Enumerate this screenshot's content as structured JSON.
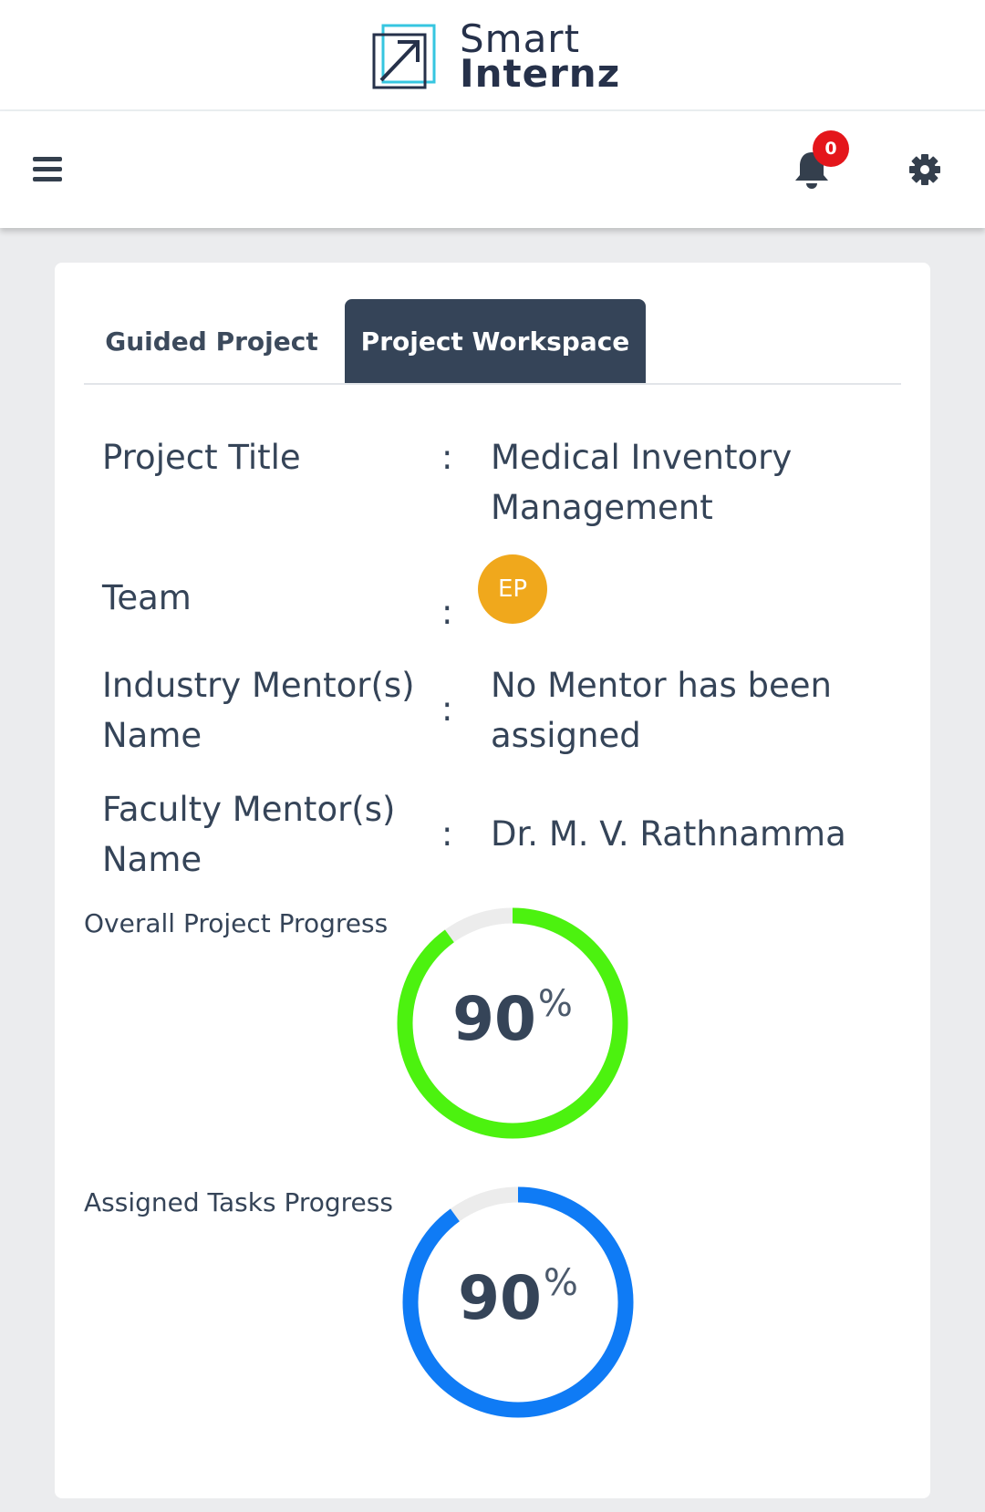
{
  "app": {
    "logo_line1": "Smart",
    "logo_line2": "Internz"
  },
  "topnav": {
    "menu_icon": "hamburger-menu-icon",
    "notification_icon": "bell-icon",
    "notification_count": "0",
    "settings_icon": "gear-icon"
  },
  "tabs": [
    {
      "label": "Guided Project",
      "active": false
    },
    {
      "label": "Project Workspace",
      "active": true
    }
  ],
  "details": {
    "project_title_label": "Project Title",
    "project_title_line1": "Medical Inventory",
    "project_title_line2": "Management",
    "team_label": "Team",
    "team_avatar": "EP",
    "industry_mentor_label_line1": "Industry Mentor(s)",
    "industry_mentor_label_line2": "Name",
    "industry_mentor_value_line1": "No Mentor has been",
    "industry_mentor_value_line2": "assigned",
    "faculty_mentor_label_line1": "Faculty Mentor(s)",
    "faculty_mentor_label_line2": "Name",
    "faculty_mentor_value": "Dr. M. V. Rathnamma",
    "colon": ":"
  },
  "progress": {
    "overall_label": "Overall Project Progress",
    "overall_value": "90",
    "overall_fraction": 0.9,
    "overall_color": "#4cf20f",
    "tasks_label": "Assigned Tasks Progress",
    "tasks_value": "90",
    "tasks_fraction": 0.9,
    "tasks_color": "#0f7bf5",
    "percent_sign": "%"
  },
  "colors": {
    "header_dark": "#354458",
    "avatar": "#f0a81c",
    "badge": "#e4161b",
    "track": "#ececec"
  }
}
